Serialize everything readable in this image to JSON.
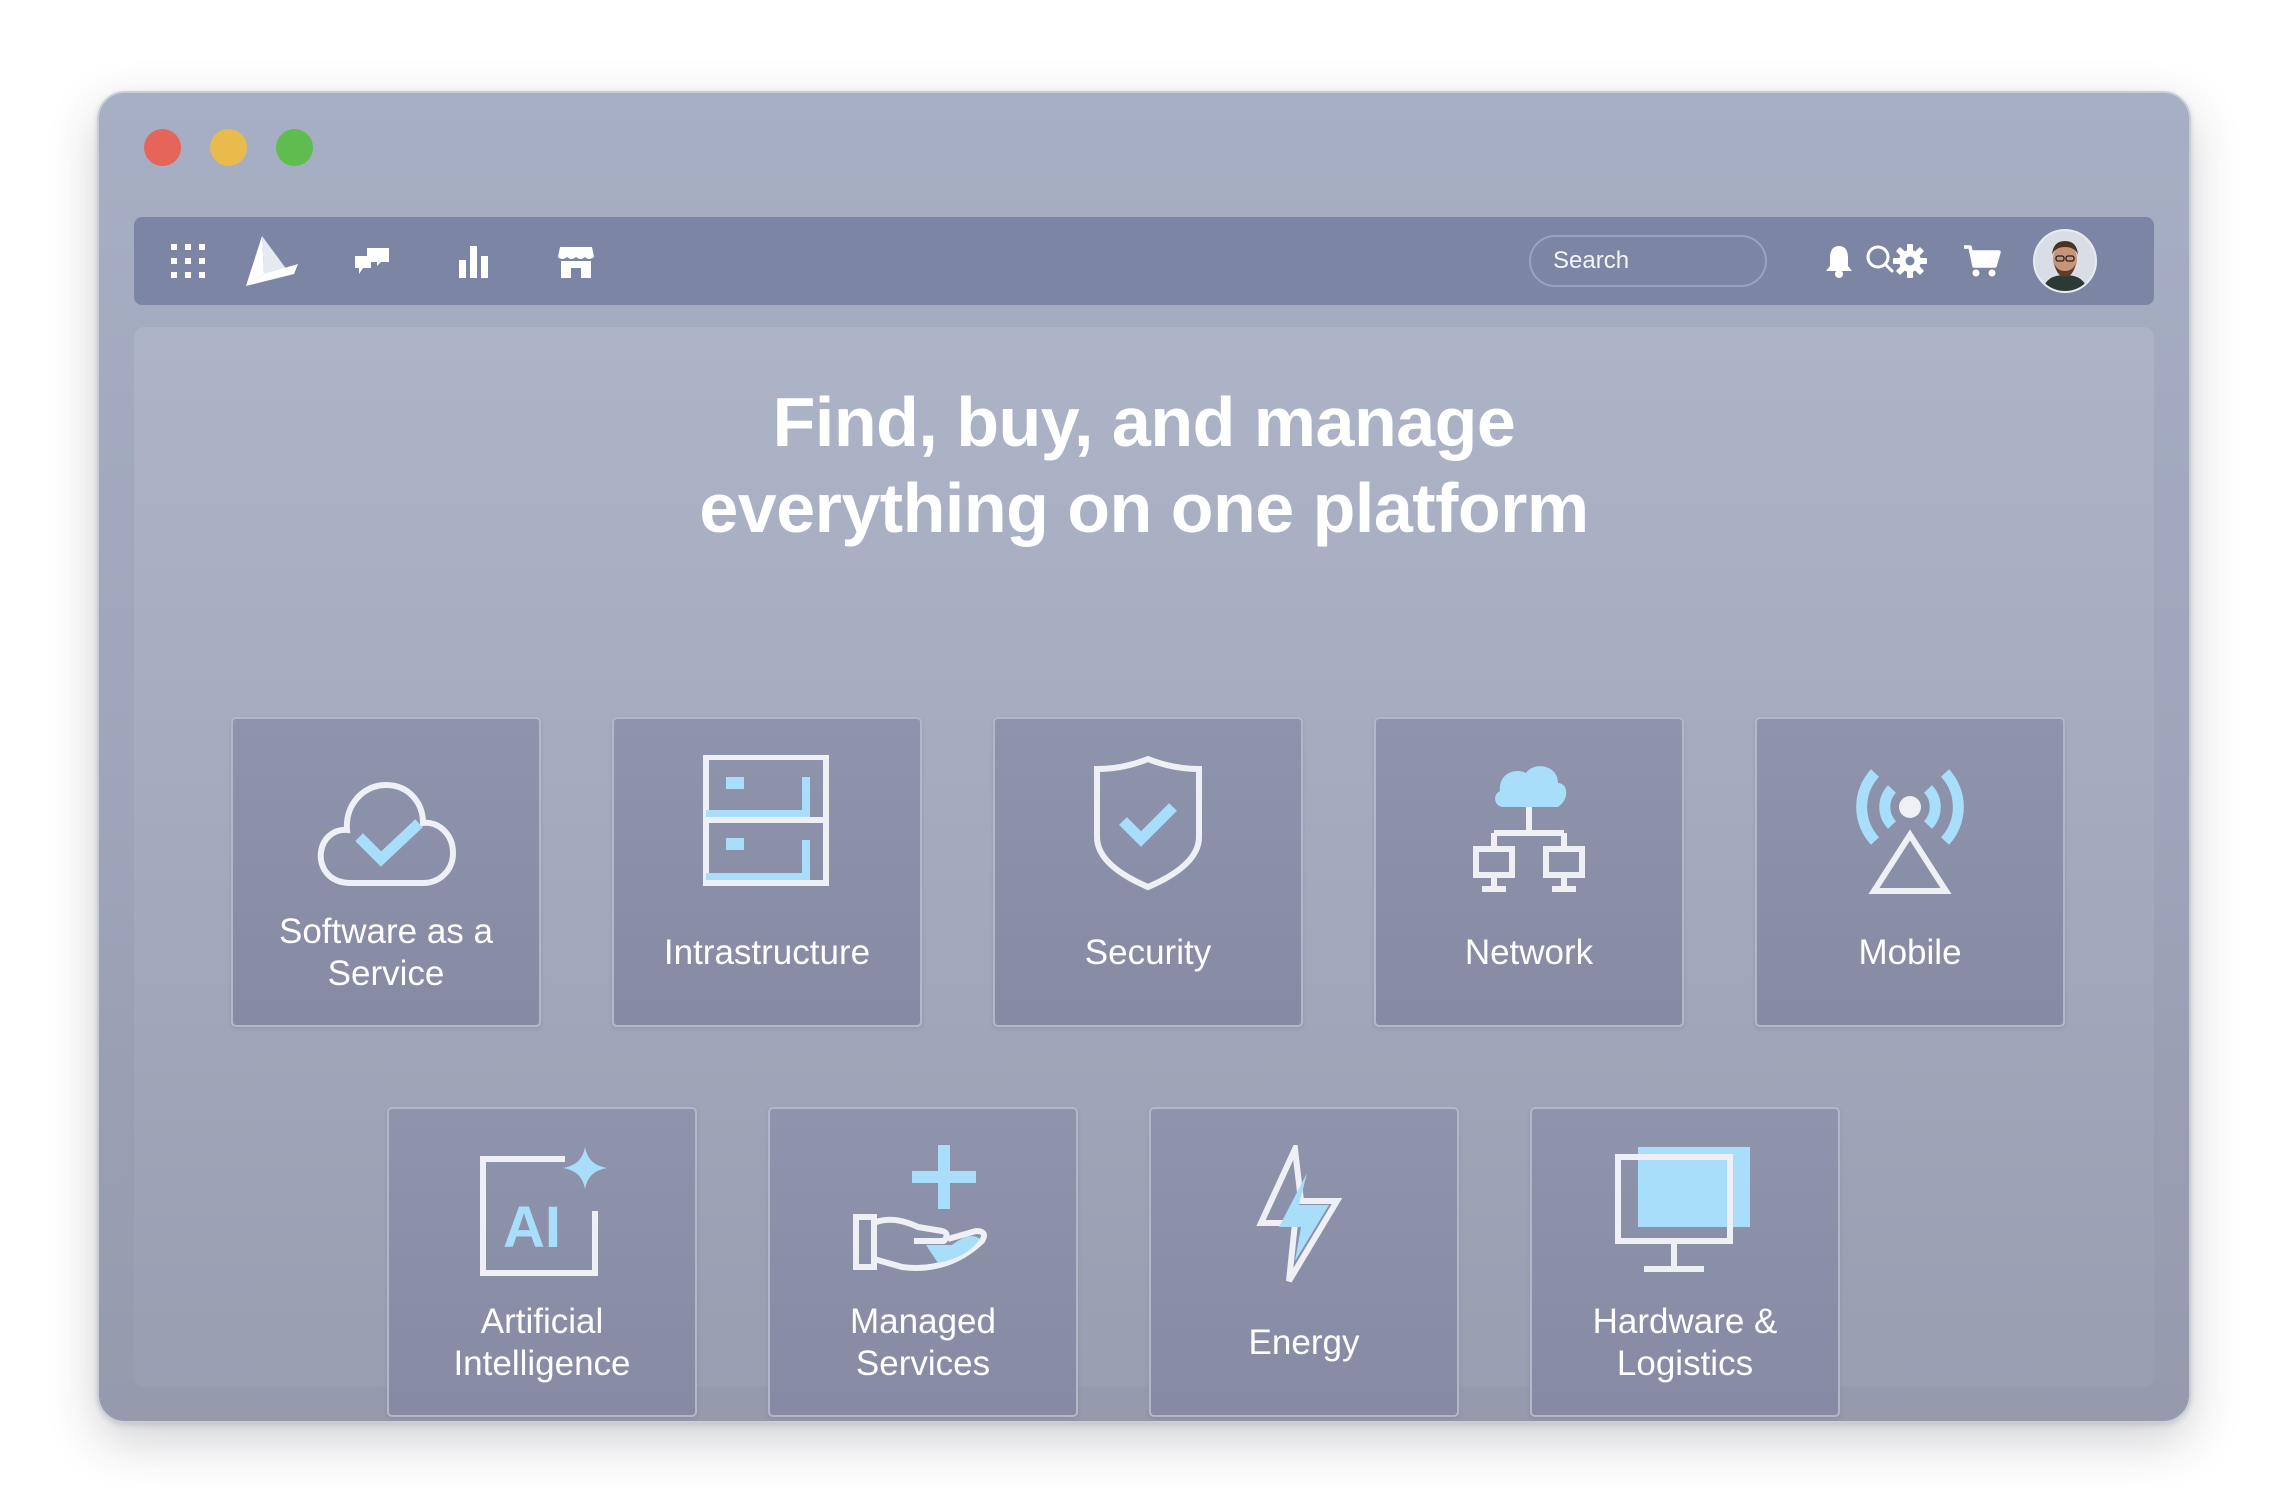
{
  "window": {
    "controls": [
      "close",
      "minimize",
      "maximize"
    ]
  },
  "navbar": {
    "icons": [
      "apps-grid-icon",
      "brand-logo-icon",
      "feedback-icon",
      "bar-chart-icon",
      "storefront-icon"
    ],
    "search": {
      "placeholder": "Search",
      "icon": "search-icon"
    },
    "right_icons": [
      "bell-icon",
      "gear-icon",
      "cart-icon"
    ],
    "avatar": "user-avatar"
  },
  "hero": {
    "line1": "Find, buy, and manage",
    "line2": "everything on one platform"
  },
  "categories": [
    {
      "label": "Software as a Service",
      "icon": "cloud-check-icon"
    },
    {
      "label": "Intrastructure",
      "icon": "server-icon"
    },
    {
      "label": "Security",
      "icon": "shield-check-icon"
    },
    {
      "label": "Network",
      "icon": "network-icon"
    },
    {
      "label": "Mobile",
      "icon": "antenna-icon"
    },
    {
      "label": "Artificial Intelligence",
      "icon": "ai-sparkle-icon"
    },
    {
      "label": "Managed Services",
      "icon": "hand-plus-icon"
    },
    {
      "label": "Energy",
      "icon": "lightning-icon"
    },
    {
      "label": "Hardware & Logistics",
      "icon": "monitor-icon"
    }
  ],
  "colors": {
    "accent": "#a8defa",
    "icon_stroke": "#eef0f5",
    "navbar": "#7c86a4",
    "card": "#8a8fa8"
  }
}
